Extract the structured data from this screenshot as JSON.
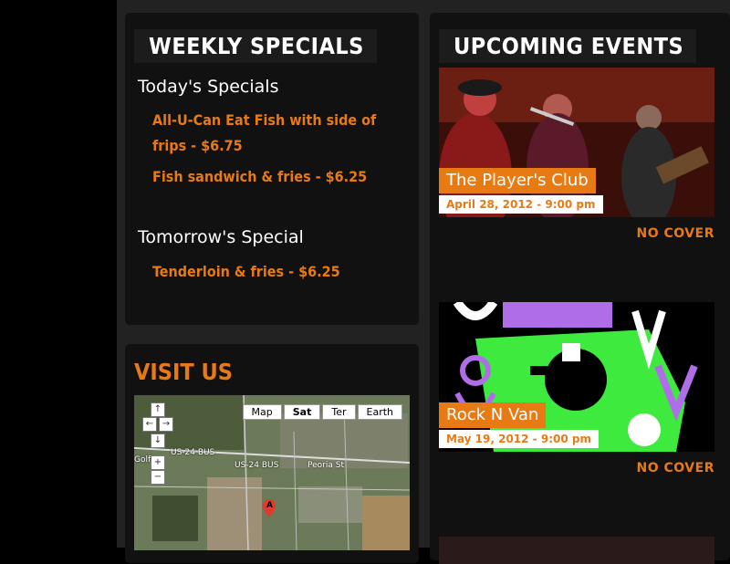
{
  "weekly_specials": {
    "title": "WEEKLY SPECIALS",
    "today_heading": "Today's Specials",
    "today_items": [
      "All-U-Can Eat Fish with side of",
      "frips - $6.75",
      "Fish sandwich & fries - $6.25"
    ],
    "tomorrow_heading": "Tomorrow's Special",
    "tomorrow_items": [
      "Tenderloin & fries - $6.25"
    ]
  },
  "visit_us": {
    "title": "VISIT US",
    "map": {
      "types": [
        "Map",
        "Sat",
        "Ter",
        "Earth"
      ],
      "selected_type": "Sat",
      "labels": [
        "US-24 BUS",
        "US-24 BUS",
        "Peoria St",
        "Golf"
      ],
      "marker": "A",
      "zoom_in": "+",
      "zoom_out": "−"
    }
  },
  "upcoming_events": {
    "title": "UPCOMING EVENTS",
    "events": [
      {
        "name": "The Player's Club",
        "date": "April 28, 2012 - 9:00 pm",
        "cover": "NO COVER"
      },
      {
        "name": "Rock N Van",
        "date": "May 19, 2012 - 9:00 pm",
        "cover": "NO COVER"
      }
    ]
  },
  "colors": {
    "accent": "#e87a14",
    "panel": "#111111",
    "background": "#222222"
  }
}
